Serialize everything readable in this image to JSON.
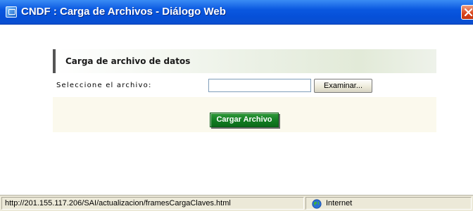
{
  "window": {
    "title": "CNDF : Carga de Archivos - Diálogo Web"
  },
  "panel": {
    "title": "Carga de archivo de datos",
    "file_label": "Seleccione el archivo:",
    "file_value": "",
    "browse_label": "Examinar...",
    "upload_label": "Cargar Archivo"
  },
  "statusbar": {
    "url": "http://201.155.117.206/SAI/actualizacion/framesCargaClaves.html",
    "zone": "Internet"
  },
  "colors": {
    "titlebar": "#0a58e0",
    "upload_button": "#127c22",
    "action_area": "#fbf9ed"
  }
}
